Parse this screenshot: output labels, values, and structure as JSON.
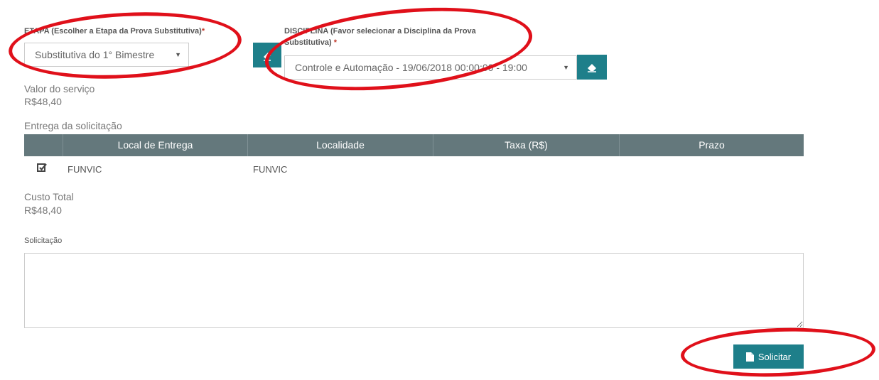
{
  "etapa": {
    "label": "ETAPA (Escolher a Etapa da Prova Substitutiva)",
    "required_mark": "*",
    "selected": "Substitutiva do 1° Bimestre"
  },
  "disciplina": {
    "label_line1": "DISCIPLINA (Favor selecionar a Disciplina da Prova",
    "label_line2": "Substitutiva)",
    "required_mark": "*",
    "selected": "Controle e Automação - 19/06/2018 00:00:00 - 19:00"
  },
  "valor": {
    "label": "Valor do serviço",
    "value": "R$48,40"
  },
  "entrega": {
    "label": "Entrega da solicitação",
    "columns": [
      "Local de Entrega",
      "Localidade",
      "Taxa (R$)",
      "Prazo"
    ],
    "rows": [
      {
        "local": "FUNVIC",
        "localidade": "FUNVIC",
        "taxa": "",
        "prazo": ""
      }
    ]
  },
  "custo": {
    "label": "Custo Total",
    "value": "R$48,40"
  },
  "solicitacao": {
    "label": "Solicitação"
  },
  "submit": {
    "label": "Solicitar"
  },
  "colors": {
    "accent": "#1e7f8a",
    "table_header": "#64787c",
    "annotation": "#e0101a"
  }
}
